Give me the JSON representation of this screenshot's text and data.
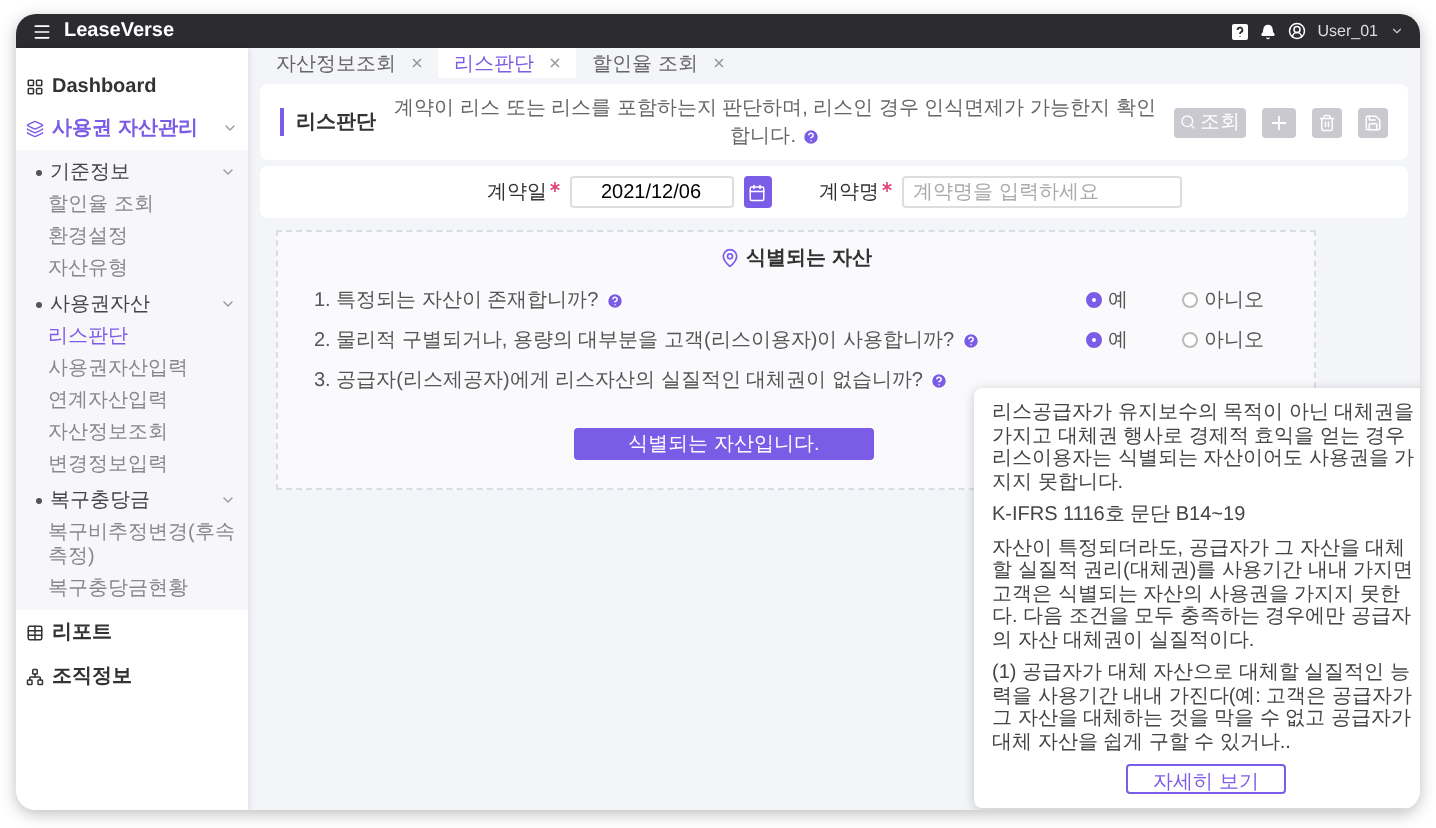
{
  "app": {
    "name": "LeaseVerse",
    "user": "User_01"
  },
  "sidebar": {
    "items": [
      {
        "label": "Dashboard",
        "kind": "grid",
        "selected": false
      },
      {
        "label": "사용권 자산관리",
        "kind": "stack",
        "selected": true,
        "expanded": true,
        "children": [
          {
            "label": "기준정보",
            "expanded": true,
            "children": [
              {
                "label": "할인율 조회",
                "selected": false
              },
              {
                "label": "환경설정",
                "selected": false
              },
              {
                "label": "자산유형",
                "selected": false
              }
            ]
          },
          {
            "label": "사용권자산",
            "expanded": true,
            "children": [
              {
                "label": "리스판단",
                "selected": true
              },
              {
                "label": "사용권자산입력",
                "selected": false
              },
              {
                "label": "연계자산입력",
                "selected": false
              },
              {
                "label": "자산정보조회",
                "selected": false
              },
              {
                "label": "변경정보입력",
                "selected": false
              }
            ]
          },
          {
            "label": "복구충당금",
            "expanded": true,
            "children": [
              {
                "label": "복구비추정변경(후속측정)",
                "selected": false
              },
              {
                "label": "복구충당금현황",
                "selected": false
              }
            ]
          }
        ]
      },
      {
        "label": "리포트",
        "kind": "table",
        "selected": false
      },
      {
        "label": "조직정보",
        "kind": "org",
        "selected": false
      }
    ]
  },
  "tabs": [
    {
      "label": "자산정보조회",
      "selected": false
    },
    {
      "label": "리스판단",
      "selected": true
    },
    {
      "label": "할인율 조회",
      "selected": false
    }
  ],
  "page": {
    "title": "리스판단",
    "description": "계약이 리스 또는 리스를 포함하는지 판단하며, 리스인 경우 인식면제가 가능한지 확인합니다.",
    "actions": [
      {
        "kind": "search",
        "label": "조회",
        "disabled": true
      },
      {
        "kind": "add",
        "disabled": true
      },
      {
        "kind": "delete",
        "disabled": true
      },
      {
        "kind": "save",
        "disabled": true
      }
    ]
  },
  "filters": [
    {
      "kind": "date",
      "label": "계약일",
      "required": true,
      "value": "2021/12/06"
    },
    {
      "kind": "text",
      "label": "계약명",
      "required": true,
      "placeholder": "계약명을 입력하세요"
    }
  ],
  "assessment": {
    "title": "식별되는 자산",
    "questions": [
      {
        "text": "1. 특정되는 자산이 존재합니까?",
        "options": [
          {
            "label": "예",
            "selected": true
          },
          {
            "label": "아니오",
            "selected": false
          }
        ]
      },
      {
        "text": "2. 물리적 구별되거나, 용량의 대부분을 고객(리스이용자)이 사용합니까?",
        "options": [
          {
            "label": "예",
            "selected": true
          },
          {
            "label": "아니오",
            "selected": false
          }
        ]
      },
      {
        "text": "3. 공급자(리스제공자)에게 리스자산의 실질적인 대체권이 없습니까?",
        "tooltip": {
          "paragraphs": [
            {
              "kind": "text",
              "text": "리스공급자가 유지보수의 목적이 아닌 대체권을 가지고 대체권 행사로 경제적 효익을 얻는 경우 리스이용자는 식별되는 자산이어도 사용권을 가지지 못합니다."
            },
            {
              "kind": "text",
              "text": "K-IFRS 1116호 문단 B14~19"
            },
            {
              "kind": "text",
              "text": "자산이 특정되더라도, 공급자가 그 자산을 대체할 실질적 권리(대체권)를 사용기간 내내 가지면 고객은 식별되는 자산의 사용권을 가지지 못한다. 다음 조건을 모두 충족하는 경우에만 공급자의 자산 대체권이 실질적이다."
            },
            {
              "kind": "item",
              "text": "(1) 공급자가 대체 자산으로 대체할 실질적인 능력을 사용기간 내내 가진다(예: 고객은 공급자가 그 자산을 대체하는 것을 막을 수 없고 공급자가 대체 자산을 쉽게 구할 수 있거나.."
            }
          ],
          "button": "자세히 보기"
        }
      }
    ],
    "result_button": "식별되는 자산입니다."
  }
}
